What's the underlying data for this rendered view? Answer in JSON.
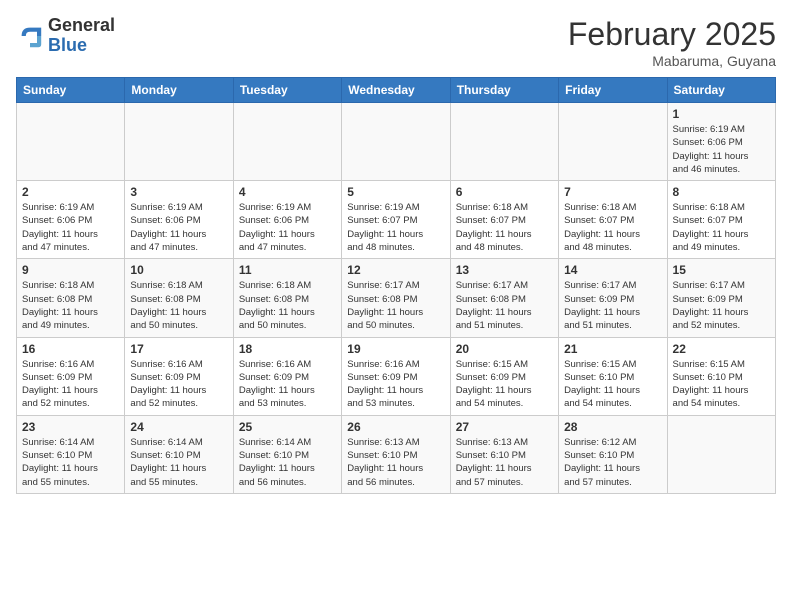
{
  "header": {
    "logo_general": "General",
    "logo_blue": "Blue",
    "month_title": "February 2025",
    "location": "Mabaruma, Guyana"
  },
  "days_of_week": [
    "Sunday",
    "Monday",
    "Tuesday",
    "Wednesday",
    "Thursday",
    "Friday",
    "Saturday"
  ],
  "weeks": [
    [
      {
        "day": "",
        "info": ""
      },
      {
        "day": "",
        "info": ""
      },
      {
        "day": "",
        "info": ""
      },
      {
        "day": "",
        "info": ""
      },
      {
        "day": "",
        "info": ""
      },
      {
        "day": "",
        "info": ""
      },
      {
        "day": "1",
        "info": "Sunrise: 6:19 AM\nSunset: 6:06 PM\nDaylight: 11 hours\nand 46 minutes."
      }
    ],
    [
      {
        "day": "2",
        "info": "Sunrise: 6:19 AM\nSunset: 6:06 PM\nDaylight: 11 hours\nand 47 minutes."
      },
      {
        "day": "3",
        "info": "Sunrise: 6:19 AM\nSunset: 6:06 PM\nDaylight: 11 hours\nand 47 minutes."
      },
      {
        "day": "4",
        "info": "Sunrise: 6:19 AM\nSunset: 6:06 PM\nDaylight: 11 hours\nand 47 minutes."
      },
      {
        "day": "5",
        "info": "Sunrise: 6:19 AM\nSunset: 6:07 PM\nDaylight: 11 hours\nand 48 minutes."
      },
      {
        "day": "6",
        "info": "Sunrise: 6:18 AM\nSunset: 6:07 PM\nDaylight: 11 hours\nand 48 minutes."
      },
      {
        "day": "7",
        "info": "Sunrise: 6:18 AM\nSunset: 6:07 PM\nDaylight: 11 hours\nand 48 minutes."
      },
      {
        "day": "8",
        "info": "Sunrise: 6:18 AM\nSunset: 6:07 PM\nDaylight: 11 hours\nand 49 minutes."
      }
    ],
    [
      {
        "day": "9",
        "info": "Sunrise: 6:18 AM\nSunset: 6:08 PM\nDaylight: 11 hours\nand 49 minutes."
      },
      {
        "day": "10",
        "info": "Sunrise: 6:18 AM\nSunset: 6:08 PM\nDaylight: 11 hours\nand 50 minutes."
      },
      {
        "day": "11",
        "info": "Sunrise: 6:18 AM\nSunset: 6:08 PM\nDaylight: 11 hours\nand 50 minutes."
      },
      {
        "day": "12",
        "info": "Sunrise: 6:17 AM\nSunset: 6:08 PM\nDaylight: 11 hours\nand 50 minutes."
      },
      {
        "day": "13",
        "info": "Sunrise: 6:17 AM\nSunset: 6:08 PM\nDaylight: 11 hours\nand 51 minutes."
      },
      {
        "day": "14",
        "info": "Sunrise: 6:17 AM\nSunset: 6:09 PM\nDaylight: 11 hours\nand 51 minutes."
      },
      {
        "day": "15",
        "info": "Sunrise: 6:17 AM\nSunset: 6:09 PM\nDaylight: 11 hours\nand 52 minutes."
      }
    ],
    [
      {
        "day": "16",
        "info": "Sunrise: 6:16 AM\nSunset: 6:09 PM\nDaylight: 11 hours\nand 52 minutes."
      },
      {
        "day": "17",
        "info": "Sunrise: 6:16 AM\nSunset: 6:09 PM\nDaylight: 11 hours\nand 52 minutes."
      },
      {
        "day": "18",
        "info": "Sunrise: 6:16 AM\nSunset: 6:09 PM\nDaylight: 11 hours\nand 53 minutes."
      },
      {
        "day": "19",
        "info": "Sunrise: 6:16 AM\nSunset: 6:09 PM\nDaylight: 11 hours\nand 53 minutes."
      },
      {
        "day": "20",
        "info": "Sunrise: 6:15 AM\nSunset: 6:09 PM\nDaylight: 11 hours\nand 54 minutes."
      },
      {
        "day": "21",
        "info": "Sunrise: 6:15 AM\nSunset: 6:10 PM\nDaylight: 11 hours\nand 54 minutes."
      },
      {
        "day": "22",
        "info": "Sunrise: 6:15 AM\nSunset: 6:10 PM\nDaylight: 11 hours\nand 54 minutes."
      }
    ],
    [
      {
        "day": "23",
        "info": "Sunrise: 6:14 AM\nSunset: 6:10 PM\nDaylight: 11 hours\nand 55 minutes."
      },
      {
        "day": "24",
        "info": "Sunrise: 6:14 AM\nSunset: 6:10 PM\nDaylight: 11 hours\nand 55 minutes."
      },
      {
        "day": "25",
        "info": "Sunrise: 6:14 AM\nSunset: 6:10 PM\nDaylight: 11 hours\nand 56 minutes."
      },
      {
        "day": "26",
        "info": "Sunrise: 6:13 AM\nSunset: 6:10 PM\nDaylight: 11 hours\nand 56 minutes."
      },
      {
        "day": "27",
        "info": "Sunrise: 6:13 AM\nSunset: 6:10 PM\nDaylight: 11 hours\nand 57 minutes."
      },
      {
        "day": "28",
        "info": "Sunrise: 6:12 AM\nSunset: 6:10 PM\nDaylight: 11 hours\nand 57 minutes."
      },
      {
        "day": "",
        "info": ""
      }
    ]
  ]
}
